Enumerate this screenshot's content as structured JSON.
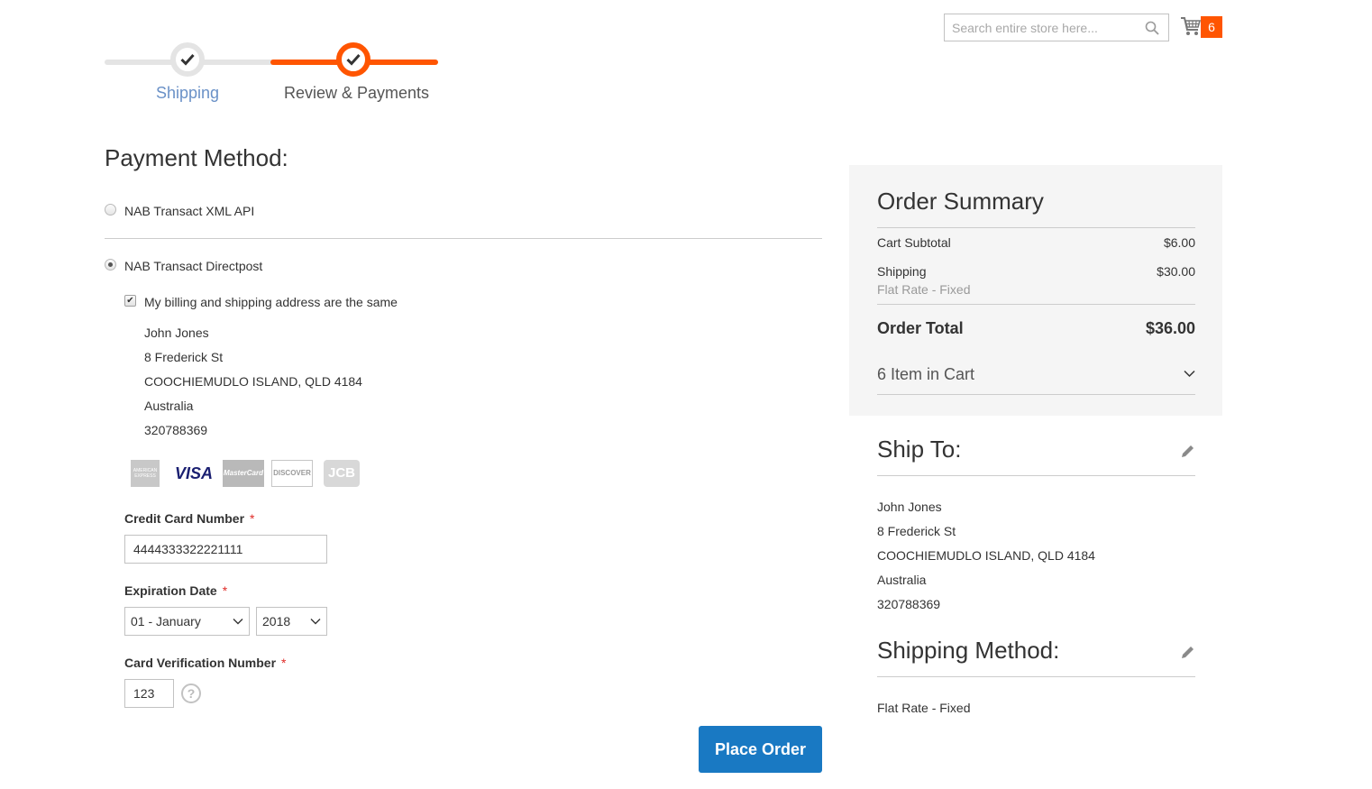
{
  "header": {
    "search_placeholder": "Search entire store here...",
    "cart_count": "6"
  },
  "progress": {
    "steps": [
      {
        "label": "Shipping",
        "state": "complete"
      },
      {
        "label": "Review & Payments",
        "state": "active"
      }
    ]
  },
  "payment": {
    "title": "Payment Method:",
    "methods": [
      {
        "label": "NAB Transact XML API",
        "selected": false
      },
      {
        "label": "NAB Transact Directpost",
        "selected": true
      }
    ],
    "same_address_label": "My billing and shipping address are the same",
    "same_address_checked": true,
    "billing_address": [
      "John Jones",
      "8 Frederick St",
      "COOCHIEMUDLO ISLAND, QLD 4184",
      "Australia",
      "320788369"
    ],
    "card_types": [
      "American Express",
      "VISA",
      "MasterCard",
      "DISCOVER",
      "JCB"
    ],
    "card_number_label": "Credit Card Number",
    "card_number_value": "4444333322221111",
    "expiration_label": "Expiration Date",
    "exp_month": "01 - January",
    "exp_year": "2018",
    "cvv_label": "Card Verification Number",
    "cvv_value": "123",
    "required_mark": "*",
    "help_glyph": "?",
    "place_order_label": "Place Order"
  },
  "summary": {
    "title": "Order Summary",
    "cart_subtotal_label": "Cart Subtotal",
    "cart_subtotal_value": "$6.00",
    "shipping_label": "Shipping",
    "shipping_method": "Flat Rate - Fixed",
    "shipping_value": "$30.00",
    "order_total_label": "Order Total",
    "order_total_value": "$36.00",
    "items_in_cart": "6 Item in Cart"
  },
  "ship_to": {
    "title": "Ship To:",
    "address": [
      "John Jones",
      "8 Frederick St",
      "COOCHIEMUDLO ISLAND, QLD 4184",
      "Australia",
      "320788369"
    ]
  },
  "shipping_method": {
    "title": "Shipping Method:",
    "value": "Flat Rate - Fixed"
  },
  "colors": {
    "accent": "#ff5501",
    "primary_button": "#1979c3",
    "link": "#6a91c7"
  }
}
